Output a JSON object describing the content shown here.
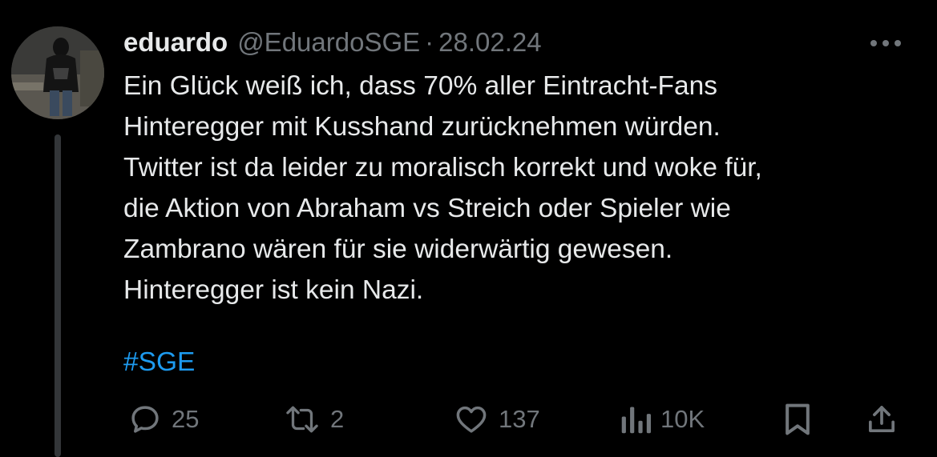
{
  "tweet": {
    "display_name": "eduardo",
    "handle": "@EduardoSGE",
    "separator": "·",
    "date": "28.02.24",
    "body_lines": [
      "Ein Glück weiß ich, dass 70% aller Eintracht-Fans",
      "Hinteregger mit Kusshand zurücknehmen würden.",
      "Twitter ist da leider zu moralisch korrekt und woke für,",
      "die Aktion von Abraham vs Streich oder Spieler wie",
      "Zambrano wären für sie widerwärtig gewesen.",
      "Hinteregger ist kein Nazi."
    ],
    "hashtag": "#SGE"
  },
  "actions": {
    "replies": "25",
    "reposts": "2",
    "likes": "137",
    "views": "10K"
  },
  "icons": {
    "more": "more-horizontal-icon",
    "reply": "reply-icon",
    "repost": "repost-icon",
    "like": "heart-icon",
    "views": "views-icon",
    "bookmark": "bookmark-icon",
    "share": "share-icon"
  },
  "colors": {
    "background": "#000000",
    "text": "#e7e9ea",
    "muted": "#71767b",
    "link": "#1d9bf0",
    "thread_line": "#333639"
  }
}
